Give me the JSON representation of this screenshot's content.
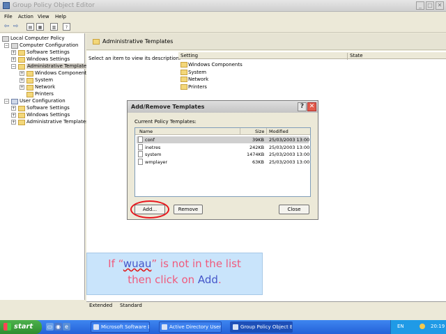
{
  "window": {
    "title": "Group Policy Object Editor"
  },
  "menu": [
    "File",
    "Action",
    "View",
    "Help"
  ],
  "toolbar": {
    "icons": [
      "back-arrow-icon",
      "forward-arrow-icon",
      "up-folder-icon",
      "show-hide-tree-icon",
      "properties-icon",
      "help-icon"
    ]
  },
  "tree": {
    "root": "Local Computer Policy",
    "computer_config": "Computer Configuration",
    "cc_software": "Software Settings",
    "cc_windows": "Windows Settings",
    "cc_admin": "Administrative Templates",
    "cc_admin_wc": "Windows Components",
    "cc_admin_system": "System",
    "cc_admin_network": "Network",
    "cc_admin_printers": "Printers",
    "user_config": "User Configuration",
    "uc_software": "Software Settings",
    "uc_windows": "Windows Settings",
    "uc_admin": "Administrative Templates"
  },
  "right": {
    "title": "Administrative Templates",
    "description": "Select an item to view its description.",
    "col_setting": "Setting",
    "col_state": "State",
    "items": [
      "Windows Components",
      "System",
      "Network",
      "Printers"
    ]
  },
  "dialog": {
    "title": "Add/Remove Templates",
    "help_btn": "?",
    "close_btn": "✕",
    "label": "Current Policy Templates:",
    "col_name": "Name",
    "col_size": "Size",
    "col_modified": "Modified",
    "rows": [
      {
        "name": "conf",
        "size": "39KB",
        "modified": "25/03/2003 13:00"
      },
      {
        "name": "inetres",
        "size": "242KB",
        "modified": "25/03/2003 13:00"
      },
      {
        "name": "system",
        "size": "1474KB",
        "modified": "25/03/2003 13:00"
      },
      {
        "name": "wmplayer",
        "size": "63KB",
        "modified": "25/03/2003 13:00"
      }
    ],
    "add_button": "Add...",
    "remove_button": "Remove",
    "close_button": "Close"
  },
  "note": {
    "line1_pre": "If “",
    "line1_kw": "wuau",
    "line1_post": "” is not in the list",
    "line2_pre": "then click on ",
    "line2_kw": "Add",
    "line2_post": "."
  },
  "tabs": {
    "extended": "Extended",
    "standard": "Standard"
  },
  "taskbar": {
    "start": "start",
    "tasks": [
      "Microsoft Software Li...",
      "Active Directory User...",
      "Group Policy Object E..."
    ],
    "lang": "EN",
    "time": "20:19"
  }
}
